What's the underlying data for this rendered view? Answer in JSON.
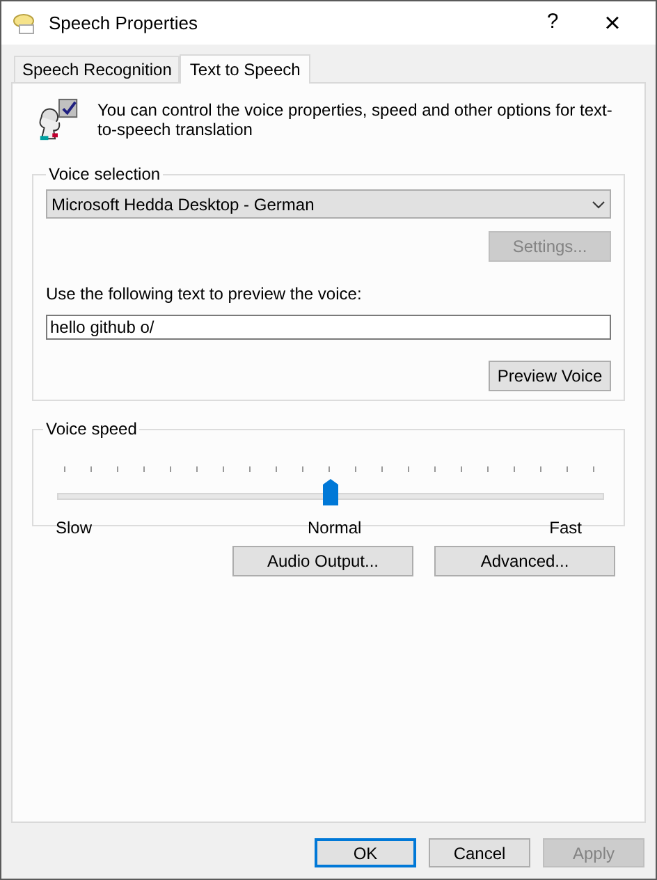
{
  "window": {
    "title": "Speech Properties",
    "help": "?",
    "close": "×"
  },
  "tabs": [
    {
      "label": "Speech Recognition",
      "selected": false
    },
    {
      "label": "Text to Speech",
      "selected": true
    }
  ],
  "intro": "You can control the voice properties, speed and other options for text-to-speech translation",
  "voice_selection": {
    "title": "Voice selection",
    "voice": "Microsoft Hedda Desktop - German",
    "settings_button": {
      "label": "Settings...",
      "disabled": true
    },
    "preview_label": "Use the following text to preview the voice:",
    "preview_text": "hello github o/",
    "preview_button": {
      "label": "Preview Voice",
      "disabled": false
    }
  },
  "voice_speed": {
    "title": "Voice speed",
    "level": 0.5,
    "labels": [
      "Slow",
      "Normal",
      "Fast"
    ]
  },
  "extra_buttons": [
    "Audio Output...",
    "Advanced..."
  ],
  "buttons": [
    {
      "label": "OK",
      "default": true,
      "disabled": false
    },
    {
      "label": "Cancel",
      "default": false,
      "disabled": false
    },
    {
      "label": "Apply",
      "default": false,
      "disabled": true
    }
  ]
}
